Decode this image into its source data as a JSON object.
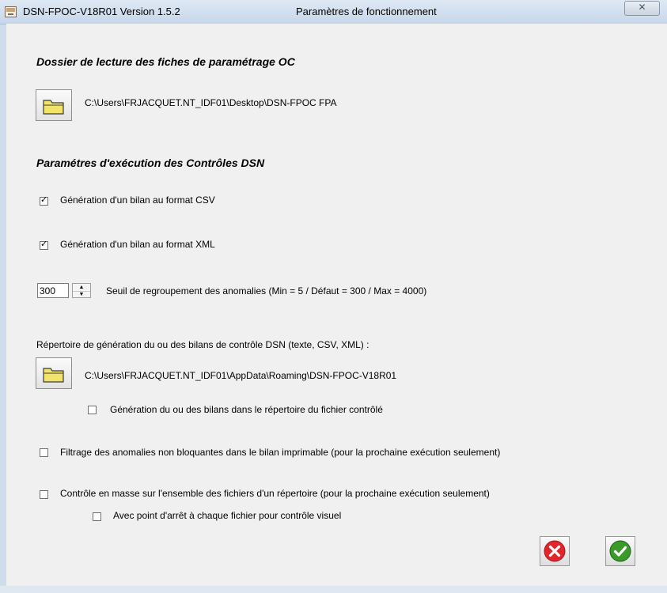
{
  "window": {
    "app_title": "DSN-FPOC-V18R01 Version 1.5.2",
    "dialog_title": "Paramètres de fonctionnement",
    "close_glyph": "✕"
  },
  "reading_section": {
    "title": "Dossier de lecture des fiches de paramétrage OC",
    "folder_path": "C:\\Users\\FRJACQUET.NT_IDF01\\Desktop\\DSN-FPOC FPA"
  },
  "execution_section": {
    "title": "Paramétres d'exécution des Contrôles DSN",
    "csv_option": {
      "label": "Génération d'un bilan au format CSV",
      "checked": true
    },
    "xml_option": {
      "label": "Génération d'un bilan au format XML",
      "checked": true
    },
    "threshold": {
      "value": "300",
      "label": "Seuil de regroupement des anomalies (Min = 5 / Défaut = 300 / Max = 4000)"
    }
  },
  "output_section": {
    "label": "Répertoire de génération du ou des bilans de contrôle DSN (texte, CSV, XML) :",
    "folder_path": "C:\\Users\\FRJACQUET.NT_IDF01\\AppData\\Roaming\\DSN-FPOC-V18R01",
    "same_dir_option": {
      "label": "Génération du ou des bilans dans le répertoire du fichier contrôlé",
      "checked": false
    }
  },
  "options": {
    "filter_option": {
      "label": "Filtrage des anomalies non bloquantes dans le bilan imprimable (pour la prochaine exécution seulement)",
      "checked": false
    },
    "mass_option": {
      "label": "Contrôle en masse sur l'ensemble des fichiers d'un répertoire (pour la prochaine exécution seulement)",
      "checked": false
    },
    "stop_option": {
      "label": "Avec point d'arrêt à chaque fichier pour contrôle visuel",
      "checked": false
    }
  },
  "actions": {
    "cancel_color": "#e0262b",
    "ok_color": "#3a9a2a",
    "cancel_icon": "close-circle-icon",
    "ok_icon": "check-circle-icon"
  },
  "colors": {
    "titlebar": "#c6d6ea",
    "client_background": "#f0f0f0",
    "folder_icon": "#f2e36a"
  }
}
